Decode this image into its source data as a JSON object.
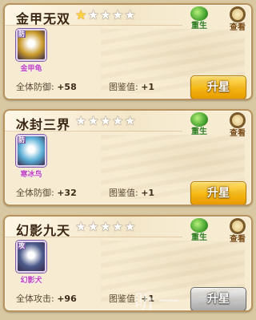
{
  "cards": [
    {
      "title": "金甲无双",
      "stars_filled": 1,
      "stars_total": 5,
      "pet_name": "金甲龟",
      "portrait_badge": "防",
      "stat1_label": "全体防御:",
      "stat1_value": "+58",
      "stat2_label": "图鉴值:",
      "stat2_value": "+1",
      "upgrade_label": "升星",
      "upgrade_enabled": true,
      "portrait_color": "#c99a2a"
    },
    {
      "title": "冰封三界",
      "stars_filled": 0,
      "stars_total": 5,
      "pet_name": "寒冰鸟",
      "portrait_badge": "防",
      "stat1_label": "全体防御:",
      "stat1_value": "+32",
      "stat2_label": "图鉴值:",
      "stat2_value": "+1",
      "upgrade_label": "升星",
      "upgrade_enabled": true,
      "portrait_color": "#5aaed6"
    },
    {
      "title": "幻影九天",
      "stars_filled": 0,
      "stars_total": 5,
      "pet_name": "幻影犬",
      "portrait_badge": "攻",
      "stat1_label": "全体攻击:",
      "stat1_value": "+96",
      "stat2_label": "图鉴值:",
      "stat2_value": "+1",
      "upgrade_label": "升星",
      "upgrade_enabled": false,
      "portrait_color": "#4a5a8a"
    }
  ],
  "buttons": {
    "rebirth_label": "重生",
    "view_label": "查看"
  },
  "watermark": "听一"
}
